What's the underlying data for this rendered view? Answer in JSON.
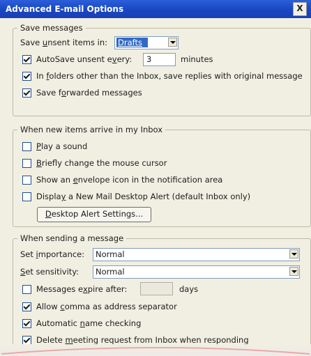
{
  "window": {
    "title": "Advanced E-mail Options",
    "close_glyph": "X"
  },
  "save_messages": {
    "legend": "Save messages",
    "save_unsent": {
      "pre": "Save ",
      "u": "u",
      "post": "nsent items in:",
      "value": "Drafts"
    },
    "autosave": {
      "pre": "AutoSave unsent e",
      "u": "v",
      "post": "ery:",
      "value": "3",
      "suffix": "minutes",
      "checked": true
    },
    "in_folders": {
      "pre": "In ",
      "u": "f",
      "post": "olders other than the Inbox, save replies with original message",
      "checked": true
    },
    "save_forwarded": {
      "pre": "Save f",
      "u": "o",
      "post": "rwarded messages",
      "checked": true
    }
  },
  "new_items": {
    "legend": "When new items arrive in my Inbox",
    "play_sound": {
      "pre": "",
      "u": "P",
      "post": "lay a sound",
      "checked": false
    },
    "briefly_change": {
      "pre": "",
      "u": "B",
      "post": "riefly change the mouse cursor",
      "checked": false
    },
    "envelope": {
      "pre": "Show an ",
      "u": "e",
      "post": "nvelope icon in the notification area",
      "checked": false
    },
    "desktop_alert": {
      "pre": "Displa",
      "u": "y",
      "post": " a New Mail Desktop Alert (default Inbox only)",
      "checked": false
    },
    "alert_settings_button": {
      "pre": "",
      "u": "D",
      "post": "esktop Alert Settings..."
    }
  },
  "sending": {
    "legend": "When sending a message",
    "importance": {
      "pre": "Set ",
      "u": "i",
      "post": "mportance:",
      "value": "Normal"
    },
    "sensitivity": {
      "pre": "",
      "u": "S",
      "post": "et sensitivity:",
      "value": "Normal"
    },
    "expire": {
      "pre": "Messages e",
      "u": "x",
      "post": "pire after:",
      "value": "",
      "suffix": "days",
      "checked": false
    },
    "allow_comma": {
      "pre": "Allow ",
      "u": "c",
      "post": "omma as address separator",
      "checked": true
    },
    "auto_name": {
      "pre": "Automatic ",
      "u": "n",
      "post": "ame checking",
      "checked": true
    },
    "delete_meeting": {
      "pre": "Delete ",
      "u": "m",
      "post": "eeting request from Inbox when responding",
      "checked": true
    }
  }
}
